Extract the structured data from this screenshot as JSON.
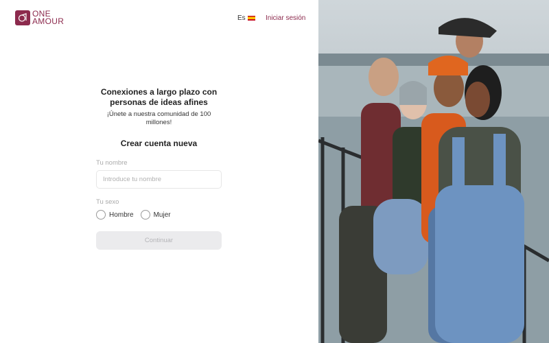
{
  "header": {
    "logo_line1": "ONE",
    "logo_line2": "AMOUR",
    "language": "Es",
    "login_link": "Iniciar sesión"
  },
  "form": {
    "headline": "Conexiones a largo plazo con personas de ideas afines",
    "subheadline": "¡Únete a nuestra comunidad de 100 millones!",
    "title": "Crear cuenta nueva",
    "name_label": "Tu nombre",
    "name_placeholder": "Introduce tu nombre",
    "sex_label": "Tu sexo",
    "option_male": "Hombre",
    "option_female": "Mujer",
    "continue_button": "Continuar"
  },
  "colors": {
    "brand": "#8c2a4d",
    "button_disabled_bg": "#ebebed",
    "button_disabled_text": "#b5b5b8"
  },
  "icons": {
    "logo": "logo-icon",
    "language_flag": "spain-flag-icon"
  }
}
